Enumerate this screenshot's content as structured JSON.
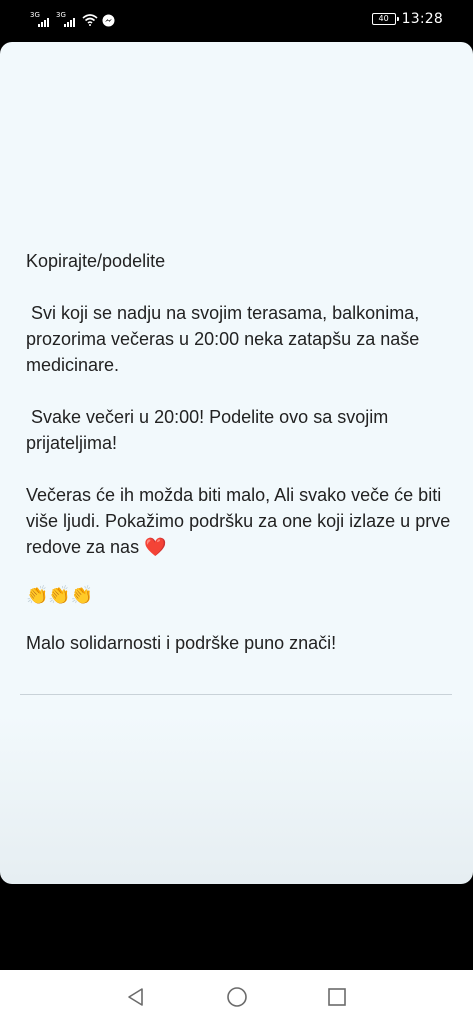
{
  "status_bar": {
    "sim1_network": "3G",
    "sim2_network": "3G",
    "battery_level": "40",
    "time": "13:28",
    "icons": [
      "signal-icon",
      "signal-icon",
      "wifi-icon",
      "messenger-icon",
      "battery-icon"
    ]
  },
  "post": {
    "title": "Kopirajte/podelite",
    "paragraph_1": " Svi koji se nadju na svojim terasama, balkonima, prozorima večeras u 20:00 neka zatapšu za naše medicinare.",
    "paragraph_2": " Svake večeri u 20:00! Podelite ovo sa svojim prijateljima!",
    "paragraph_3": "Večeras će ih možda biti malo, Ali svako veče će biti više ljudi. Pokažimo podršku za one koji izlaze u prve redove za nas",
    "heart_emoji": "❤️",
    "clapping_emojis": "👏👏👏",
    "closing": "Malo solidarnosti i podrške puno znači!"
  },
  "nav_bar": {
    "icons": [
      "back-icon",
      "home-icon",
      "recent-apps-icon"
    ]
  }
}
